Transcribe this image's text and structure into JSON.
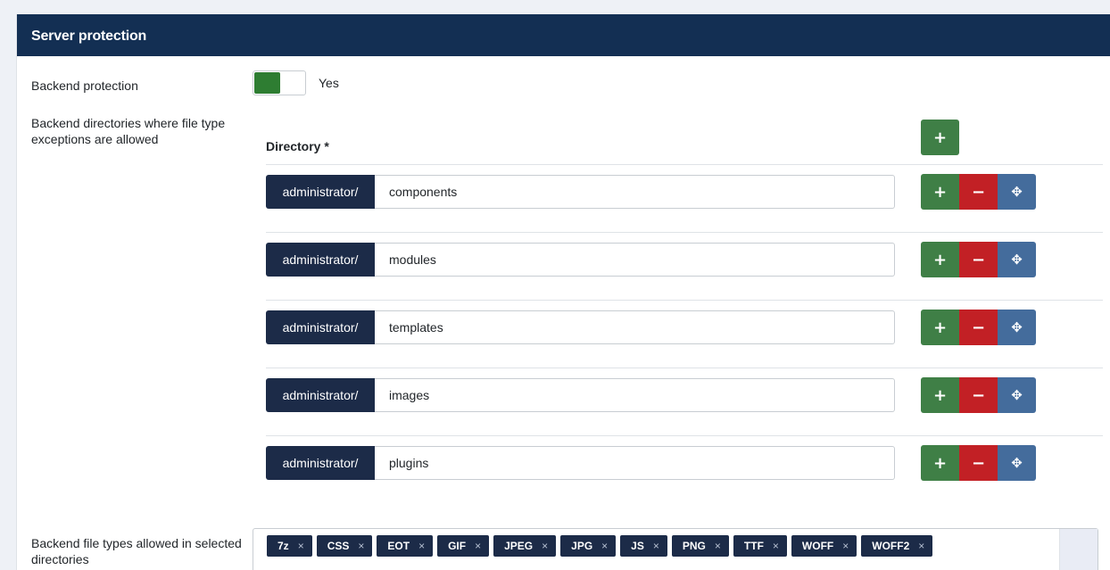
{
  "section": {
    "title": "Server protection"
  },
  "backend_protection": {
    "label": "Backend protection",
    "toggle_value": "Yes",
    "enabled": true,
    "toggle_color": "#2e7d32"
  },
  "backend_directories": {
    "label": "Backend directories where file type exceptions are allowed",
    "column_header": "Directory *",
    "rows": [
      {
        "prefix": "administrator/",
        "value": "components"
      },
      {
        "prefix": "administrator/",
        "value": "modules"
      },
      {
        "prefix": "administrator/",
        "value": "templates"
      },
      {
        "prefix": "administrator/",
        "value": "images"
      },
      {
        "prefix": "administrator/",
        "value": "plugins"
      }
    ],
    "buttons": {
      "add": "+",
      "remove": "−",
      "move": "✥"
    }
  },
  "backend_file_types": {
    "label": "Backend file types allowed in selected directories",
    "remove_symbol": "×",
    "tags": [
      "7z",
      "CSS",
      "EOT",
      "GIF",
      "JPEG",
      "JPG",
      "JS",
      "PNG",
      "TTF",
      "WOFF",
      "WOFF2"
    ]
  },
  "colors": {
    "header": "#132f53",
    "add": "#3f7f46",
    "remove": "#c22025",
    "move": "#446c9c",
    "prefix": "#1c2b48"
  }
}
